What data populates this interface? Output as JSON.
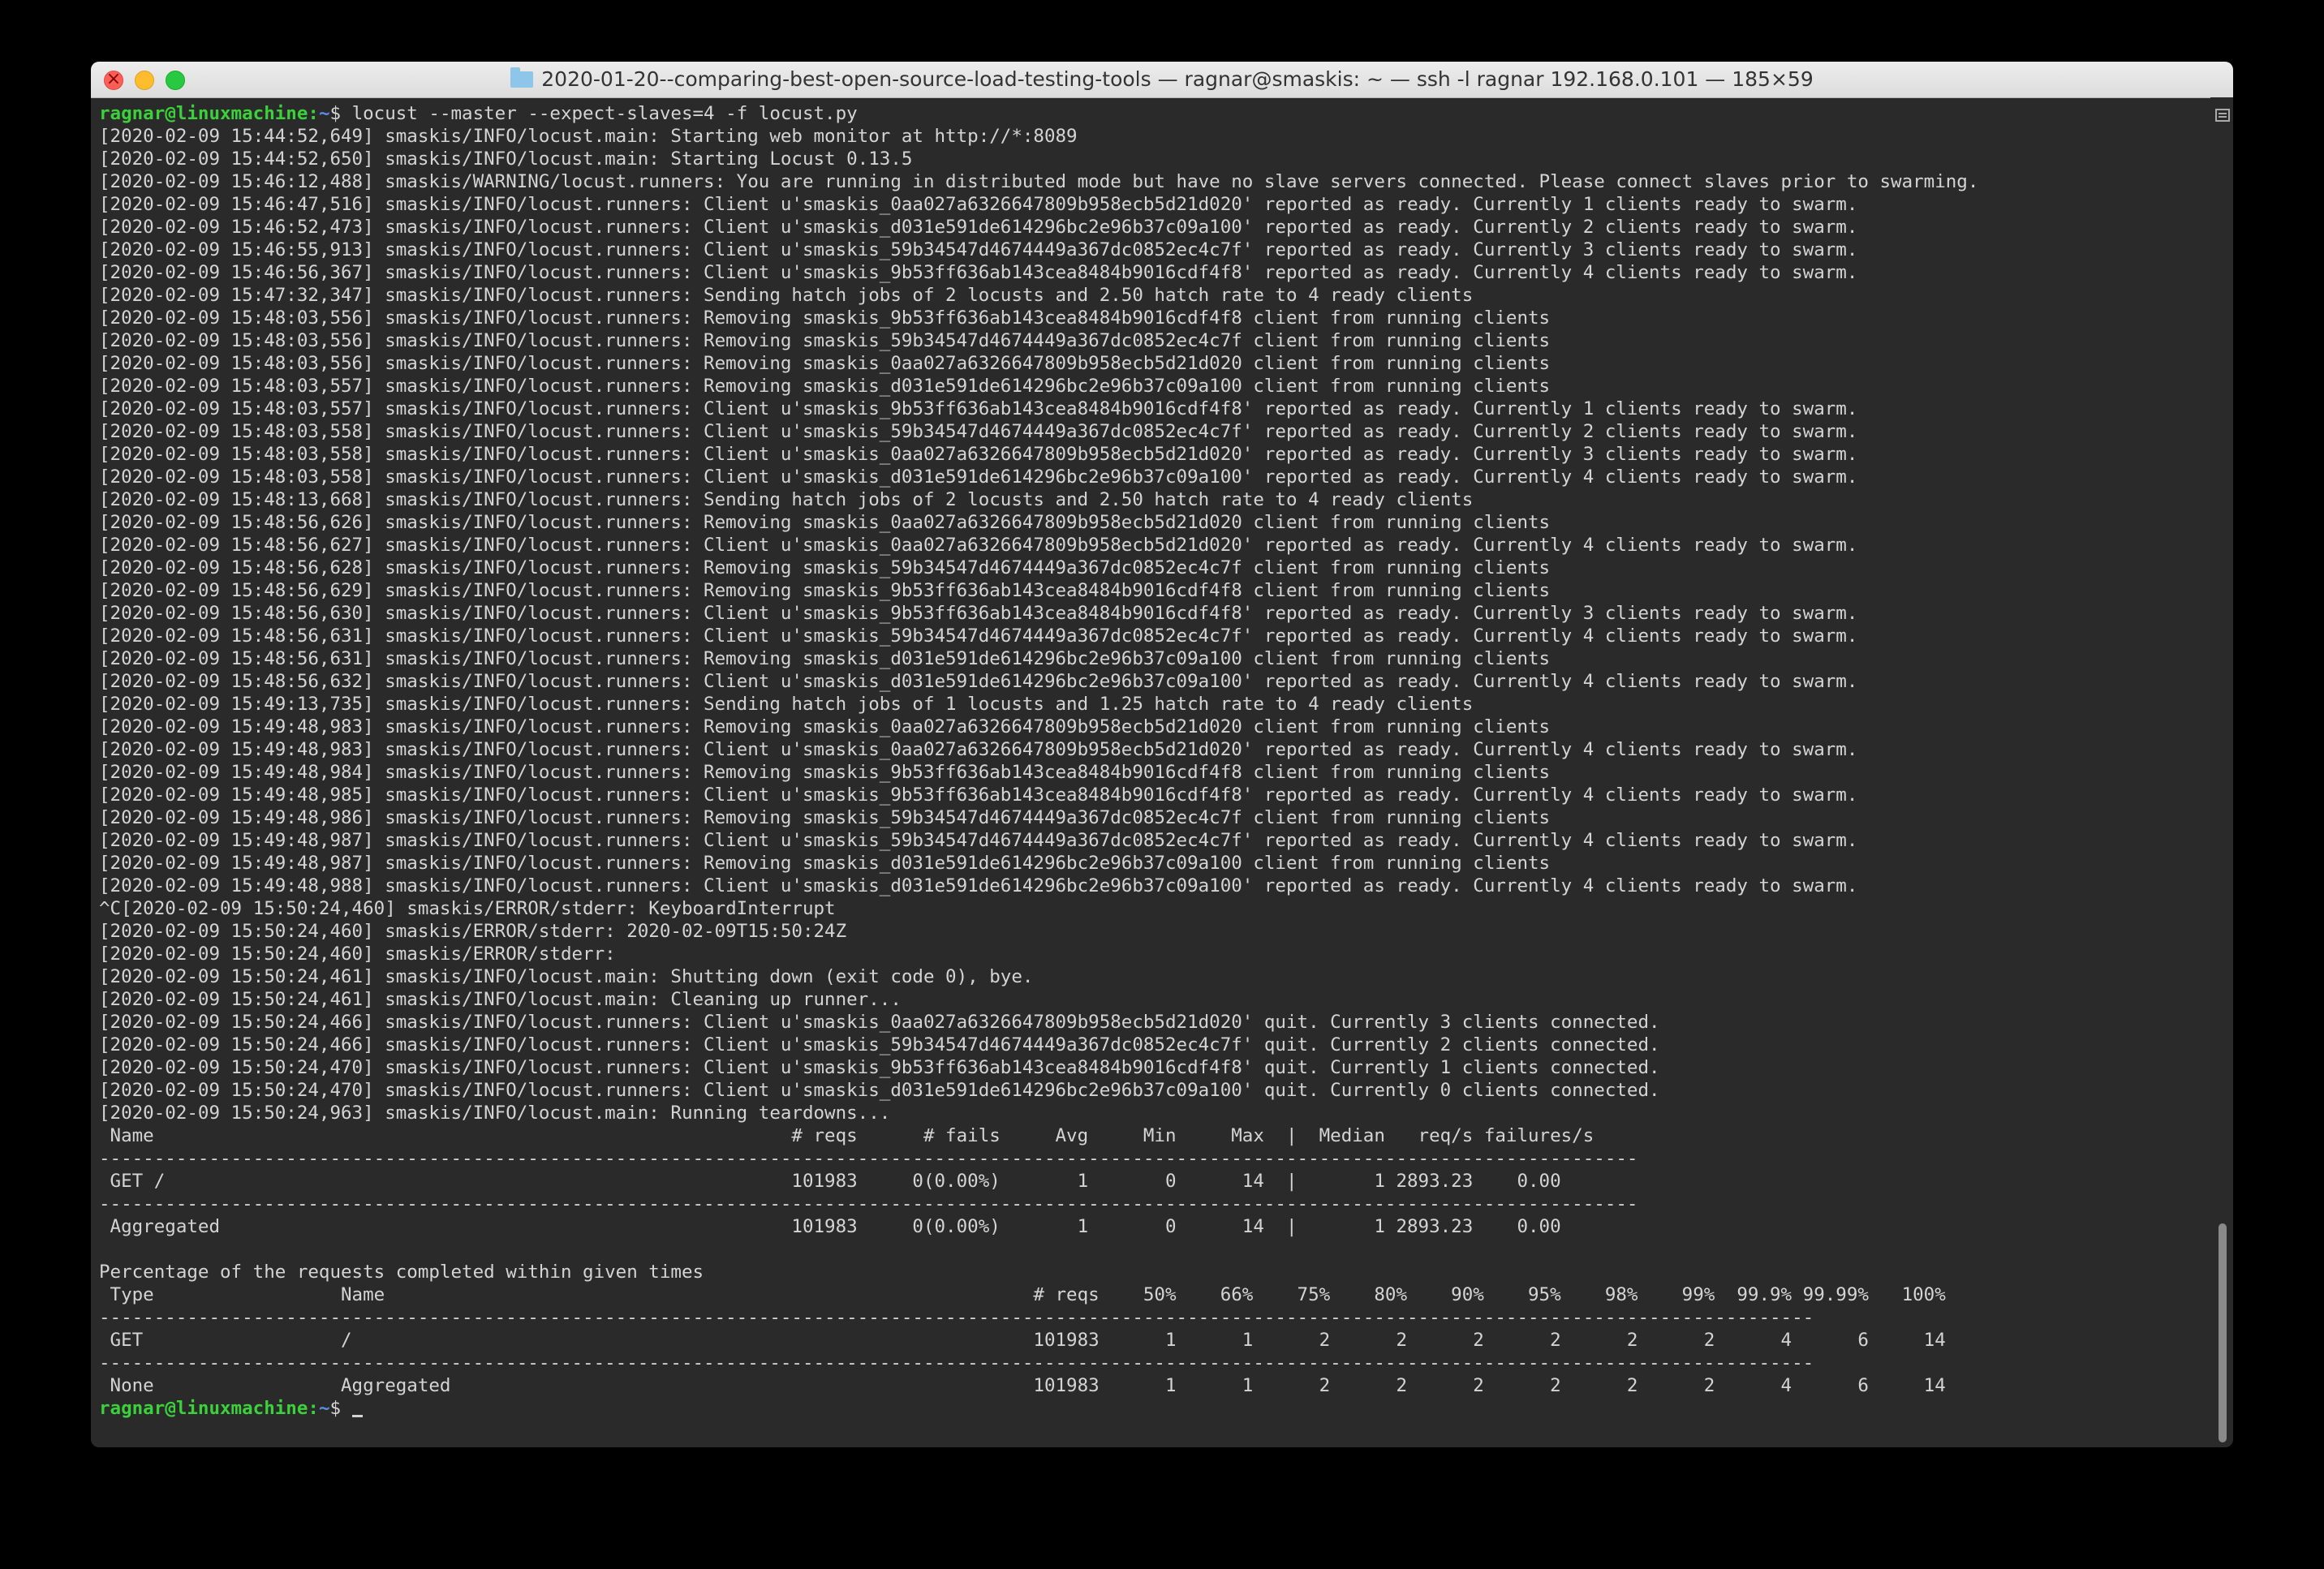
{
  "window": {
    "title": "2020-01-20--comparing-best-open-source-load-testing-tools — ragnar@smaskis: ~ — ssh -l ragnar 192.168.0.101 — 185×59"
  },
  "colors": {
    "terminal_bg": "#2a2a2a",
    "text": "#d4d4d4",
    "prompt_user": "#3bd13b",
    "prompt_path": "#5b8de6"
  },
  "prompt": {
    "user_host": "ragnar@linuxmachine",
    "separator": ":",
    "path": "~",
    "symbol": "$ "
  },
  "command": "locust --master --expect-slaves=4 -f locust.py",
  "output": [
    "[2020-02-09 15:44:52,649] smaskis/INFO/locust.main: Starting web monitor at http://*:8089",
    "[2020-02-09 15:44:52,650] smaskis/INFO/locust.main: Starting Locust 0.13.5",
    "[2020-02-09 15:46:12,488] smaskis/WARNING/locust.runners: You are running in distributed mode but have no slave servers connected. Please connect slaves prior to swarming.",
    "[2020-02-09 15:46:47,516] smaskis/INFO/locust.runners: Client u'smaskis_0aa027a6326647809b958ecb5d21d020' reported as ready. Currently 1 clients ready to swarm.",
    "[2020-02-09 15:46:52,473] smaskis/INFO/locust.runners: Client u'smaskis_d031e591de614296bc2e96b37c09a100' reported as ready. Currently 2 clients ready to swarm.",
    "[2020-02-09 15:46:55,913] smaskis/INFO/locust.runners: Client u'smaskis_59b34547d4674449a367dc0852ec4c7f' reported as ready. Currently 3 clients ready to swarm.",
    "[2020-02-09 15:46:56,367] smaskis/INFO/locust.runners: Client u'smaskis_9b53ff636ab143cea8484b9016cdf4f8' reported as ready. Currently 4 clients ready to swarm.",
    "[2020-02-09 15:47:32,347] smaskis/INFO/locust.runners: Sending hatch jobs of 2 locusts and 2.50 hatch rate to 4 ready clients",
    "[2020-02-09 15:48:03,556] smaskis/INFO/locust.runners: Removing smaskis_9b53ff636ab143cea8484b9016cdf4f8 client from running clients",
    "[2020-02-09 15:48:03,556] smaskis/INFO/locust.runners: Removing smaskis_59b34547d4674449a367dc0852ec4c7f client from running clients",
    "[2020-02-09 15:48:03,556] smaskis/INFO/locust.runners: Removing smaskis_0aa027a6326647809b958ecb5d21d020 client from running clients",
    "[2020-02-09 15:48:03,557] smaskis/INFO/locust.runners: Removing smaskis_d031e591de614296bc2e96b37c09a100 client from running clients",
    "[2020-02-09 15:48:03,557] smaskis/INFO/locust.runners: Client u'smaskis_9b53ff636ab143cea8484b9016cdf4f8' reported as ready. Currently 1 clients ready to swarm.",
    "[2020-02-09 15:48:03,558] smaskis/INFO/locust.runners: Client u'smaskis_59b34547d4674449a367dc0852ec4c7f' reported as ready. Currently 2 clients ready to swarm.",
    "[2020-02-09 15:48:03,558] smaskis/INFO/locust.runners: Client u'smaskis_0aa027a6326647809b958ecb5d21d020' reported as ready. Currently 3 clients ready to swarm.",
    "[2020-02-09 15:48:03,558] smaskis/INFO/locust.runners: Client u'smaskis_d031e591de614296bc2e96b37c09a100' reported as ready. Currently 4 clients ready to swarm.",
    "[2020-02-09 15:48:13,668] smaskis/INFO/locust.runners: Sending hatch jobs of 2 locusts and 2.50 hatch rate to 4 ready clients",
    "[2020-02-09 15:48:56,626] smaskis/INFO/locust.runners: Removing smaskis_0aa027a6326647809b958ecb5d21d020 client from running clients",
    "[2020-02-09 15:48:56,627] smaskis/INFO/locust.runners: Client u'smaskis_0aa027a6326647809b958ecb5d21d020' reported as ready. Currently 4 clients ready to swarm.",
    "[2020-02-09 15:48:56,628] smaskis/INFO/locust.runners: Removing smaskis_59b34547d4674449a367dc0852ec4c7f client from running clients",
    "[2020-02-09 15:48:56,629] smaskis/INFO/locust.runners: Removing smaskis_9b53ff636ab143cea8484b9016cdf4f8 client from running clients",
    "[2020-02-09 15:48:56,630] smaskis/INFO/locust.runners: Client u'smaskis_9b53ff636ab143cea8484b9016cdf4f8' reported as ready. Currently 3 clients ready to swarm.",
    "[2020-02-09 15:48:56,631] smaskis/INFO/locust.runners: Client u'smaskis_59b34547d4674449a367dc0852ec4c7f' reported as ready. Currently 4 clients ready to swarm.",
    "[2020-02-09 15:48:56,631] smaskis/INFO/locust.runners: Removing smaskis_d031e591de614296bc2e96b37c09a100 client from running clients",
    "[2020-02-09 15:48:56,632] smaskis/INFO/locust.runners: Client u'smaskis_d031e591de614296bc2e96b37c09a100' reported as ready. Currently 4 clients ready to swarm.",
    "[2020-02-09 15:49:13,735] smaskis/INFO/locust.runners: Sending hatch jobs of 1 locusts and 1.25 hatch rate to 4 ready clients",
    "[2020-02-09 15:49:48,983] smaskis/INFO/locust.runners: Removing smaskis_0aa027a6326647809b958ecb5d21d020 client from running clients",
    "[2020-02-09 15:49:48,983] smaskis/INFO/locust.runners: Client u'smaskis_0aa027a6326647809b958ecb5d21d020' reported as ready. Currently 4 clients ready to swarm.",
    "[2020-02-09 15:49:48,984] smaskis/INFO/locust.runners: Removing smaskis_9b53ff636ab143cea8484b9016cdf4f8 client from running clients",
    "[2020-02-09 15:49:48,985] smaskis/INFO/locust.runners: Client u'smaskis_9b53ff636ab143cea8484b9016cdf4f8' reported as ready. Currently 4 clients ready to swarm.",
    "[2020-02-09 15:49:48,986] smaskis/INFO/locust.runners: Removing smaskis_59b34547d4674449a367dc0852ec4c7f client from running clients",
    "[2020-02-09 15:49:48,987] smaskis/INFO/locust.runners: Client u'smaskis_59b34547d4674449a367dc0852ec4c7f' reported as ready. Currently 4 clients ready to swarm.",
    "[2020-02-09 15:49:48,987] smaskis/INFO/locust.runners: Removing smaskis_d031e591de614296bc2e96b37c09a100 client from running clients",
    "[2020-02-09 15:49:48,988] smaskis/INFO/locust.runners: Client u'smaskis_d031e591de614296bc2e96b37c09a100' reported as ready. Currently 4 clients ready to swarm.",
    "^C[2020-02-09 15:50:24,460] smaskis/ERROR/stderr: KeyboardInterrupt",
    "[2020-02-09 15:50:24,460] smaskis/ERROR/stderr: 2020-02-09T15:50:24Z",
    "[2020-02-09 15:50:24,460] smaskis/ERROR/stderr:",
    "[2020-02-09 15:50:24,461] smaskis/INFO/locust.main: Shutting down (exit code 0), bye.",
    "[2020-02-09 15:50:24,461] smaskis/INFO/locust.main: Cleaning up runner...",
    "[2020-02-09 15:50:24,466] smaskis/INFO/locust.runners: Client u'smaskis_0aa027a6326647809b958ecb5d21d020' quit. Currently 3 clients connected.",
    "[2020-02-09 15:50:24,466] smaskis/INFO/locust.runners: Client u'smaskis_59b34547d4674449a367dc0852ec4c7f' quit. Currently 2 clients connected.",
    "[2020-02-09 15:50:24,470] smaskis/INFO/locust.runners: Client u'smaskis_9b53ff636ab143cea8484b9016cdf4f8' quit. Currently 1 clients connected.",
    "[2020-02-09 15:50:24,470] smaskis/INFO/locust.runners: Client u'smaskis_d031e591de614296bc2e96b37c09a100' quit. Currently 0 clients connected.",
    "[2020-02-09 15:50:24,963] smaskis/INFO/locust.main: Running teardowns...",
    " Name                                                          # reqs      # fails     Avg     Min     Max  |  Median   req/s failures/s",
    "--------------------------------------------------------------------------------------------------------------------------------------------",
    " GET /                                                         101983     0(0.00%)       1       0      14  |       1 2893.23    0.00",
    "--------------------------------------------------------------------------------------------------------------------------------------------",
    " Aggregated                                                    101983     0(0.00%)       1       0      14  |       1 2893.23    0.00",
    "",
    "Percentage of the requests completed within given times",
    " Type                 Name                                                           # reqs    50%    66%    75%    80%    90%    95%    98%    99%  99.9% 99.99%   100%",
    "------------------------------------------------------------------------------------------------------------------------------------------------------------",
    " GET                  /                                                              101983      1      1      2      2      2      2      2      2      4      6     14",
    "------------------------------------------------------------------------------------------------------------------------------------------------------------",
    " None                 Aggregated                                                     101983      1      1      2      2      2      2      2      2      4      6     14",
    ""
  ]
}
